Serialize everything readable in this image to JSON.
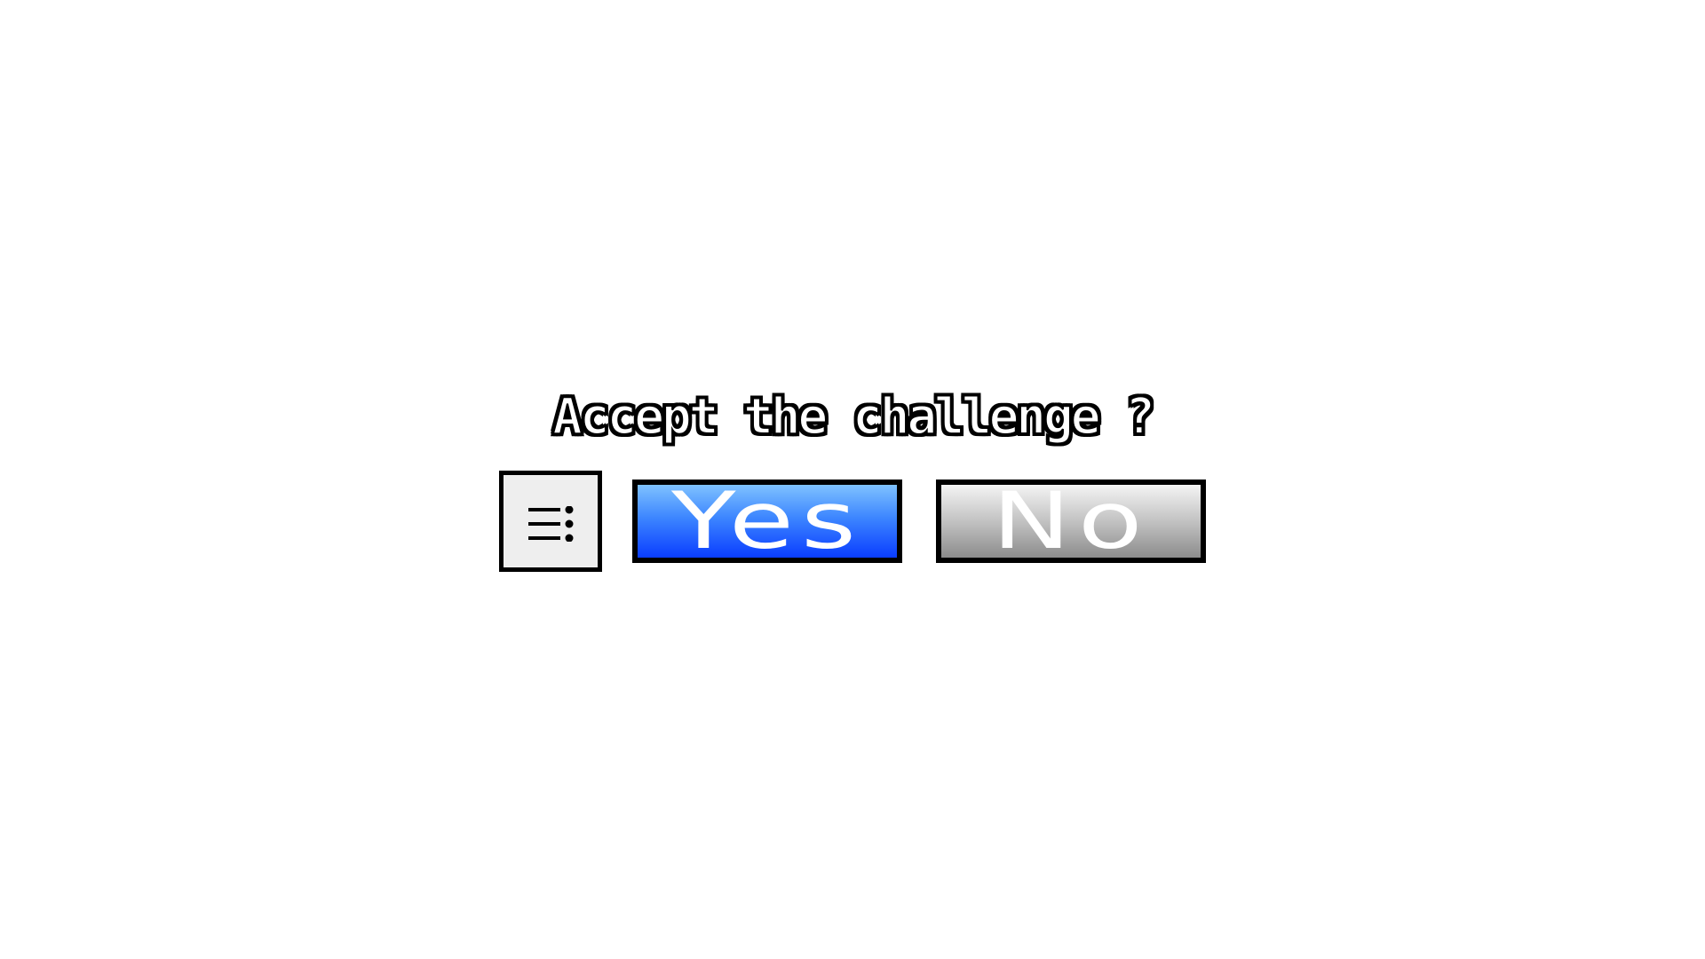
{
  "dialog": {
    "question": "Accept the challenge ?",
    "menu_icon": "menu-list-icon",
    "yes_label": "Yes",
    "no_label": "No"
  },
  "colors": {
    "yes_gradient_top": "#7fc2ff",
    "yes_gradient_bottom": "#0a3dff",
    "no_gradient_top": "#f4f4f4",
    "no_gradient_bottom": "#8c8c8c",
    "menu_background": "#eeeeee",
    "border": "#000000"
  }
}
